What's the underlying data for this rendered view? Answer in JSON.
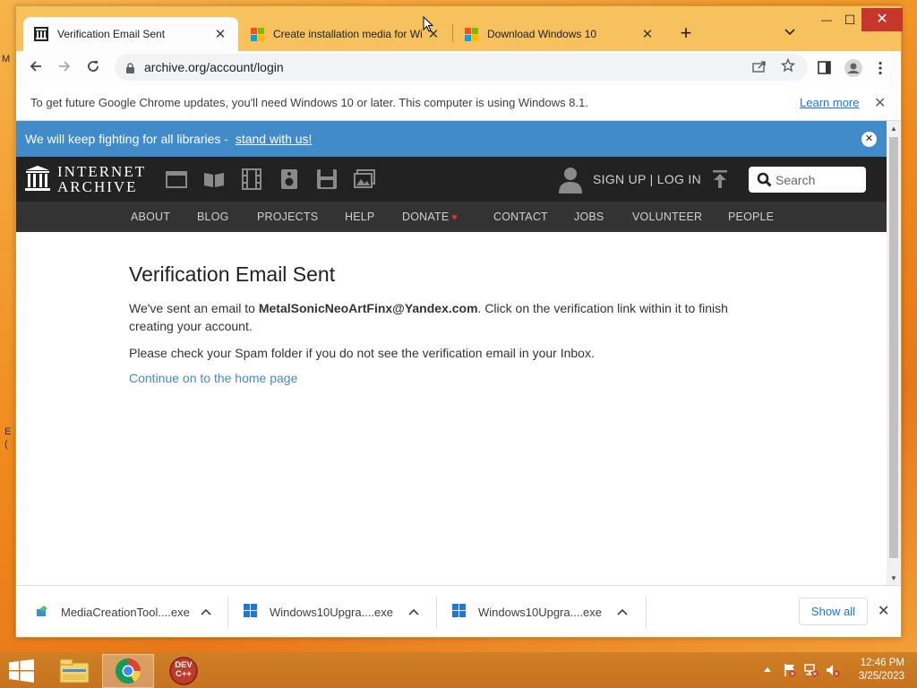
{
  "desktop": {
    "edge_fragments": [
      "M",
      "E",
      "("
    ]
  },
  "browser": {
    "tabs": [
      {
        "title": "Verification Email Sent",
        "favicon": "internet-archive-icon"
      },
      {
        "title": "Create installation media for Wi",
        "favicon": "microsoft-icon"
      },
      {
        "title": "Download Windows 10",
        "favicon": "microsoft-icon"
      }
    ],
    "new_tab_label": "+",
    "window_controls": {
      "minimize": "—",
      "maximize": "☐",
      "close": "✕"
    },
    "url": "archive.org/account/login",
    "infobar": {
      "message": "To get future Google Chrome updates, you'll need Windows 10 or later. This computer is using Windows 8.1.",
      "link": "Learn more"
    }
  },
  "page": {
    "banner": {
      "text": "We will keep fighting for all libraries - ",
      "link": "stand with us!"
    },
    "logo": {
      "line1": "INTERNET",
      "line2": "ARCHIVE"
    },
    "media_icons": [
      "web-icon",
      "texts-icon",
      "video-icon",
      "audio-icon",
      "software-icon",
      "images-icon"
    ],
    "auth_text": "SIGN UP | LOG IN",
    "search_placeholder": "Search",
    "nav": [
      "ABOUT",
      "BLOG",
      "PROJECTS",
      "HELP",
      "DONATE",
      "CONTACT",
      "JOBS",
      "VOLUNTEER",
      "PEOPLE"
    ],
    "heading": "Verification Email Sent",
    "paragraph1_prefix": "We've sent an email to ",
    "email": "MetalSonicNeoArtFinx@Yandex.com",
    "paragraph1_suffix": ". Click on the verification link within it to finish creating your account.",
    "paragraph2": "Please check your Spam folder if you do not see the verification email in your Inbox.",
    "continue_link": "Continue on to the home page"
  },
  "downloads": {
    "items": [
      {
        "name": "MediaCreationTool....exe"
      },
      {
        "name": "Windows10Upgra....exe"
      },
      {
        "name": "Windows10Upgra....exe"
      }
    ],
    "show_all": "Show all"
  },
  "taskbar": {
    "apps": [
      "file-explorer-icon",
      "chrome-icon",
      "dev-cpp-icon"
    ],
    "devcpp_label": "DEV C++",
    "time": "12:46 PM",
    "date": "3/25/2023"
  },
  "colors": {
    "banner": "#428bca",
    "ia_header": "#222222",
    "ia_nav": "#333333",
    "link": "#428bca",
    "chrome_link": "#1a73e8",
    "titlebar": "#f7c25e"
  }
}
